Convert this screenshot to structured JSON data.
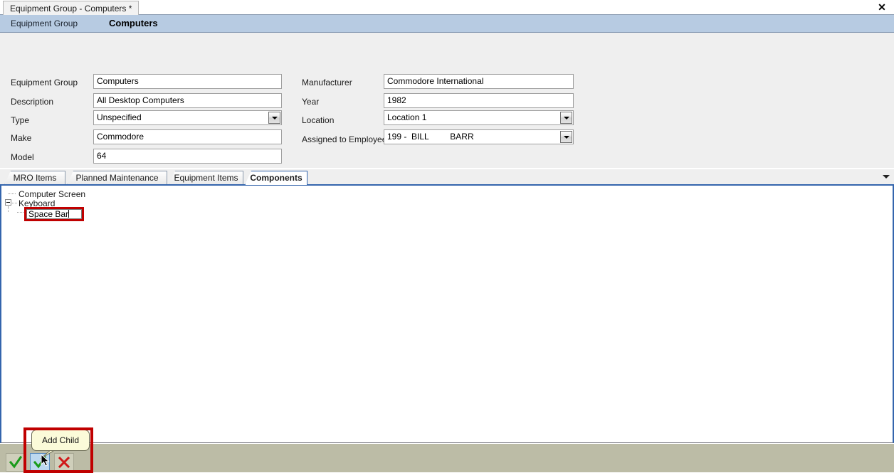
{
  "window": {
    "tab_title": "Equipment Group - Computers *",
    "close_icon": "close-icon"
  },
  "header": {
    "label": "Equipment Group",
    "title": "Computers"
  },
  "form": {
    "left_fields": [
      {
        "label": "Equipment Group",
        "value": "Computers",
        "type": "text"
      },
      {
        "label": "Description",
        "value": "All Desktop Computers",
        "type": "text"
      },
      {
        "label": "Type",
        "value": "Unspecified",
        "type": "combo"
      },
      {
        "label": "Make",
        "value": "Commodore",
        "type": "text"
      },
      {
        "label": "Model",
        "value": "64",
        "type": "text"
      }
    ],
    "right_fields": [
      {
        "label": "Manufacturer",
        "value": "Commodore International",
        "type": "text"
      },
      {
        "label": "Year",
        "value": "1982",
        "type": "text"
      },
      {
        "label": "Location",
        "value": "Location 1",
        "type": "combo"
      },
      {
        "label": "Assigned to Employee",
        "value": "199 -  BILL         BARR",
        "type": "combo"
      }
    ]
  },
  "tabs": [
    {
      "label": "MRO Items",
      "active": false
    },
    {
      "label": "Planned Maintenance",
      "active": false
    },
    {
      "label": "Equipment Items",
      "active": false
    },
    {
      "label": "Components",
      "active": true
    }
  ],
  "tree": {
    "nodes": [
      {
        "label": "Computer Screen",
        "expander": "none"
      },
      {
        "label": "Keyboard",
        "expander": "collapse"
      }
    ],
    "editing_node": {
      "label": "Space Bar",
      "is_editing": true
    }
  },
  "toolbar": {
    "buttons": [
      {
        "name": "accept-button",
        "icon": "check-icon",
        "hovered": false
      },
      {
        "name": "add-child-button",
        "icon": "check-plus-icon",
        "hovered": true
      },
      {
        "name": "cancel-button",
        "icon": "x-icon",
        "hovered": false
      }
    ],
    "tooltip": "Add Child"
  },
  "colors": {
    "header_band": "#b7cbe2",
    "form_background": "#efefef",
    "tab_underline": "#3465ad",
    "bottom_area": "#bcbca6",
    "highlight_red": "#c00000",
    "tooltip_background": "#fbfbd9",
    "hover_blue": "#bcd8ef"
  }
}
